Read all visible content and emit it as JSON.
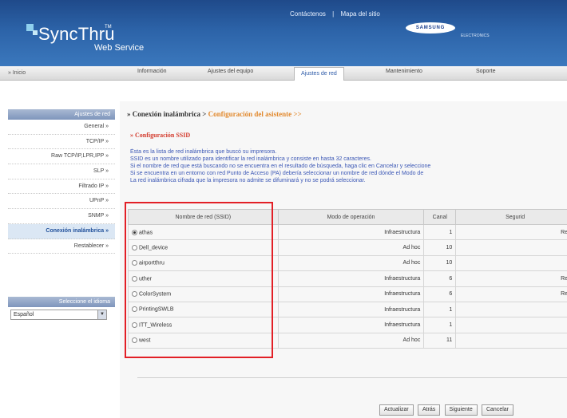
{
  "header": {
    "logo": "SyncThru",
    "logo_tm": "TM",
    "logo_sub": "Web Service",
    "top_links": [
      "Contáctenos",
      "|",
      "Mapa del sitio"
    ],
    "brand": "SAMSUNG",
    "brand_sub": "ELECTRONICS"
  },
  "nav": {
    "home": "» Inicio",
    "tabs": [
      "Información",
      "Ajustes del equipo",
      "Ajustes de red",
      "Mantenimiento",
      "Soporte"
    ],
    "active_tab": "Ajustes de red"
  },
  "sidebar": {
    "title": "Ajustes de red",
    "items": [
      {
        "label": "General »"
      },
      {
        "label": "TCP/IP »"
      },
      {
        "label": "Raw TCP/IP,LPR,IPP »"
      },
      {
        "label": "SLP »"
      },
      {
        "label": "Filtrado IP »"
      },
      {
        "label": "UPnP »"
      },
      {
        "label": "SNMP »"
      },
      {
        "label": "Conexión inalámbrica »"
      },
      {
        "label": "Restablecer »"
      }
    ],
    "active": "Conexión inalámbrica »",
    "language_title": "Seleccione el idioma",
    "language_value": "Español"
  },
  "main": {
    "breadcrumb_root": "» Conexión inalámbrica > ",
    "breadcrumb_current": "Configuración del asistente >>",
    "section_title": "» Configuración SSID",
    "description": [
      "Ésta es la lista de red inalámbrica que buscó su impresora.",
      "SSID es un nombre utilizado para identificar la red inalámbrica y consiste en hasta 32 caracteres.",
      "Si el nombre de red que está buscando no se encuentra en el resultado de búsqueda, haga clic en Cancelar y seleccione",
      "Si se encuentra en un entorno con red Punto de Acceso (PA) debería seleccionar un nombre de red dónde el Modo de",
      "La red inalámbrica cifrada que la impresora no admite se difuminará y no se podrá seleccionar."
    ],
    "table": {
      "headers": [
        "Nombre de red (SSID)",
        "Modo de operación",
        "Canal",
        "Segurid"
      ],
      "rows": [
        {
          "ssid": "athas",
          "mode": "Infraestructura",
          "channel": "1",
          "security": "Red"
        },
        {
          "ssid": "Dell_device",
          "mode": "Ad hoc",
          "channel": "10",
          "security": ""
        },
        {
          "ssid": "airportthru",
          "mode": "Ad hoc",
          "channel": "10",
          "security": ""
        },
        {
          "ssid": "uther",
          "mode": "Infraestructura",
          "channel": "6",
          "security": "Red"
        },
        {
          "ssid": "ColorSystem",
          "mode": "Infraestructura",
          "channel": "6",
          "security": "Red"
        },
        {
          "ssid": "PrintingSWLB",
          "mode": "Infraestructura",
          "channel": "1",
          "security": ""
        },
        {
          "ssid": "ITT_Wireless",
          "mode": "Infraestructura",
          "channel": "1",
          "security": ""
        },
        {
          "ssid": "west",
          "mode": "Ad hoc",
          "channel": "11",
          "security": ""
        }
      ],
      "selected_row": 0
    },
    "buttons": [
      "Actualizar",
      "Atrás",
      "Siguiente",
      "Cancelar"
    ]
  },
  "colors": {
    "header_blue": "#2c63a8",
    "description_text": "#3b57b5",
    "section_title": "#d33a2c",
    "highlight_box": "#e21f26"
  }
}
